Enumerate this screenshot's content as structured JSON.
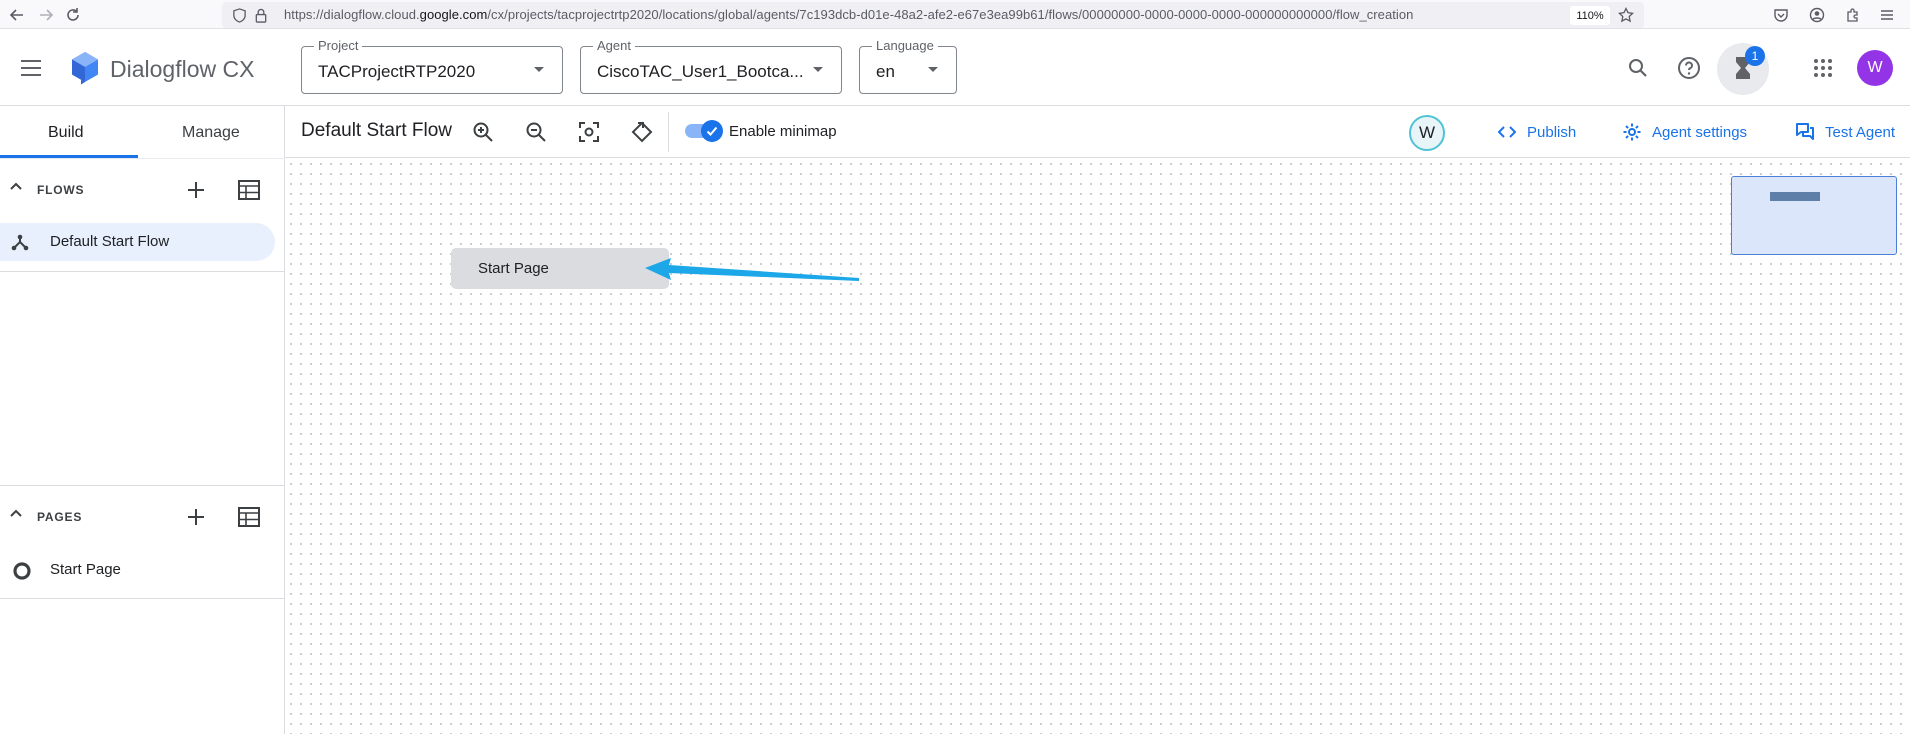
{
  "browser": {
    "url_prefix": "https://dialogflow.cloud.",
    "url_domain": "google.com",
    "url_rest": "/cx/projects/tacprojectrtp2020/locations/global/agents/7c193dcb-d01e-48a2-afe2-e67e3ea99b61/flows/00000000-0000-0000-0000-000000000000/flow_creation",
    "zoom": "110%"
  },
  "app": {
    "brand": "Dialogflow CX",
    "brand_color": "#4285f4",
    "project": {
      "label": "Project",
      "value": "TACProjectRTP2020"
    },
    "agent": {
      "label": "Agent",
      "value": "CiscoTAC_User1_Bootca..."
    },
    "language": {
      "label": "Language",
      "value": "en"
    },
    "notification_count": "1",
    "avatar_initial": "W"
  },
  "left_panel": {
    "tabs": [
      {
        "label": "Build",
        "active": true
      },
      {
        "label": "Manage",
        "active": false
      }
    ],
    "flows": {
      "title": "FLOWS",
      "items": [
        {
          "label": "Default Start Flow",
          "selected": true
        }
      ]
    },
    "pages": {
      "title": "PAGES",
      "items": [
        {
          "label": "Start Page"
        }
      ]
    }
  },
  "toolbar": {
    "flow_title": "Default Start Flow",
    "minimap_label": "Enable minimap",
    "minimap_enabled": true,
    "collaborator_initial": "W",
    "publish_label": "Publish",
    "agent_settings_label": "Agent settings",
    "test_agent_label": "Test Agent",
    "accent_color": "#1a73e8"
  },
  "canvas": {
    "nodes": [
      {
        "label": "Start Page"
      }
    ],
    "annotation_color": "#1ba7e8"
  }
}
